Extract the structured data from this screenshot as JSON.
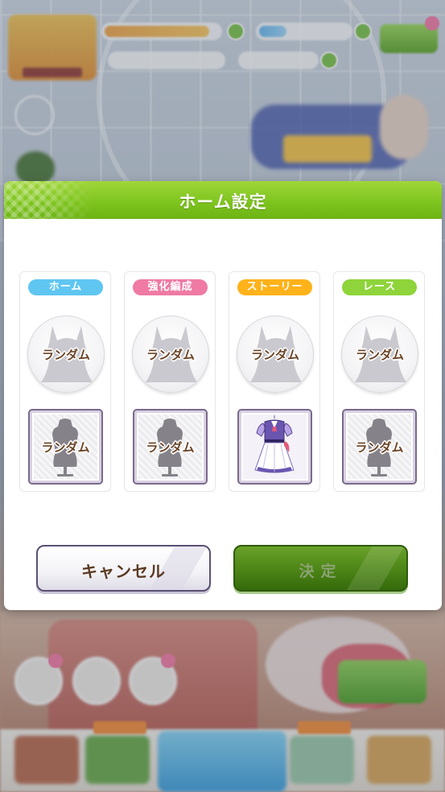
{
  "dialog": {
    "title": "ホーム設定"
  },
  "slots": [
    {
      "tag": "ホーム",
      "tag_color": "#5fc6f2",
      "character_label": "ランダム",
      "outfit_label": "ランダム",
      "outfit_selected": false
    },
    {
      "tag": "強化編成",
      "tag_color": "#ef7aa3",
      "character_label": "ランダム",
      "outfit_label": "ランダム",
      "outfit_selected": false
    },
    {
      "tag": "ストーリー",
      "tag_color": "#ffb21a",
      "character_label": "ランダム",
      "outfit_label": "",
      "outfit_selected": true
    },
    {
      "tag": "レース",
      "tag_color": "#8ed43a",
      "character_label": "ランダム",
      "outfit_label": "ランダム",
      "outfit_selected": false
    }
  ],
  "buttons": {
    "cancel_label": "キャンセル",
    "ok_label": "決定",
    "ok_enabled": false
  },
  "colors": {
    "header_green": "#7fc51f",
    "ok_green": "#4c8416",
    "label_brown": "#6b4426"
  },
  "icons": {
    "character_placeholder": "horse-girl-silhouette-icon",
    "outfit_placeholder": "dress-form-icon",
    "outfit_selected": "purple-uniform-dress-icon"
  }
}
